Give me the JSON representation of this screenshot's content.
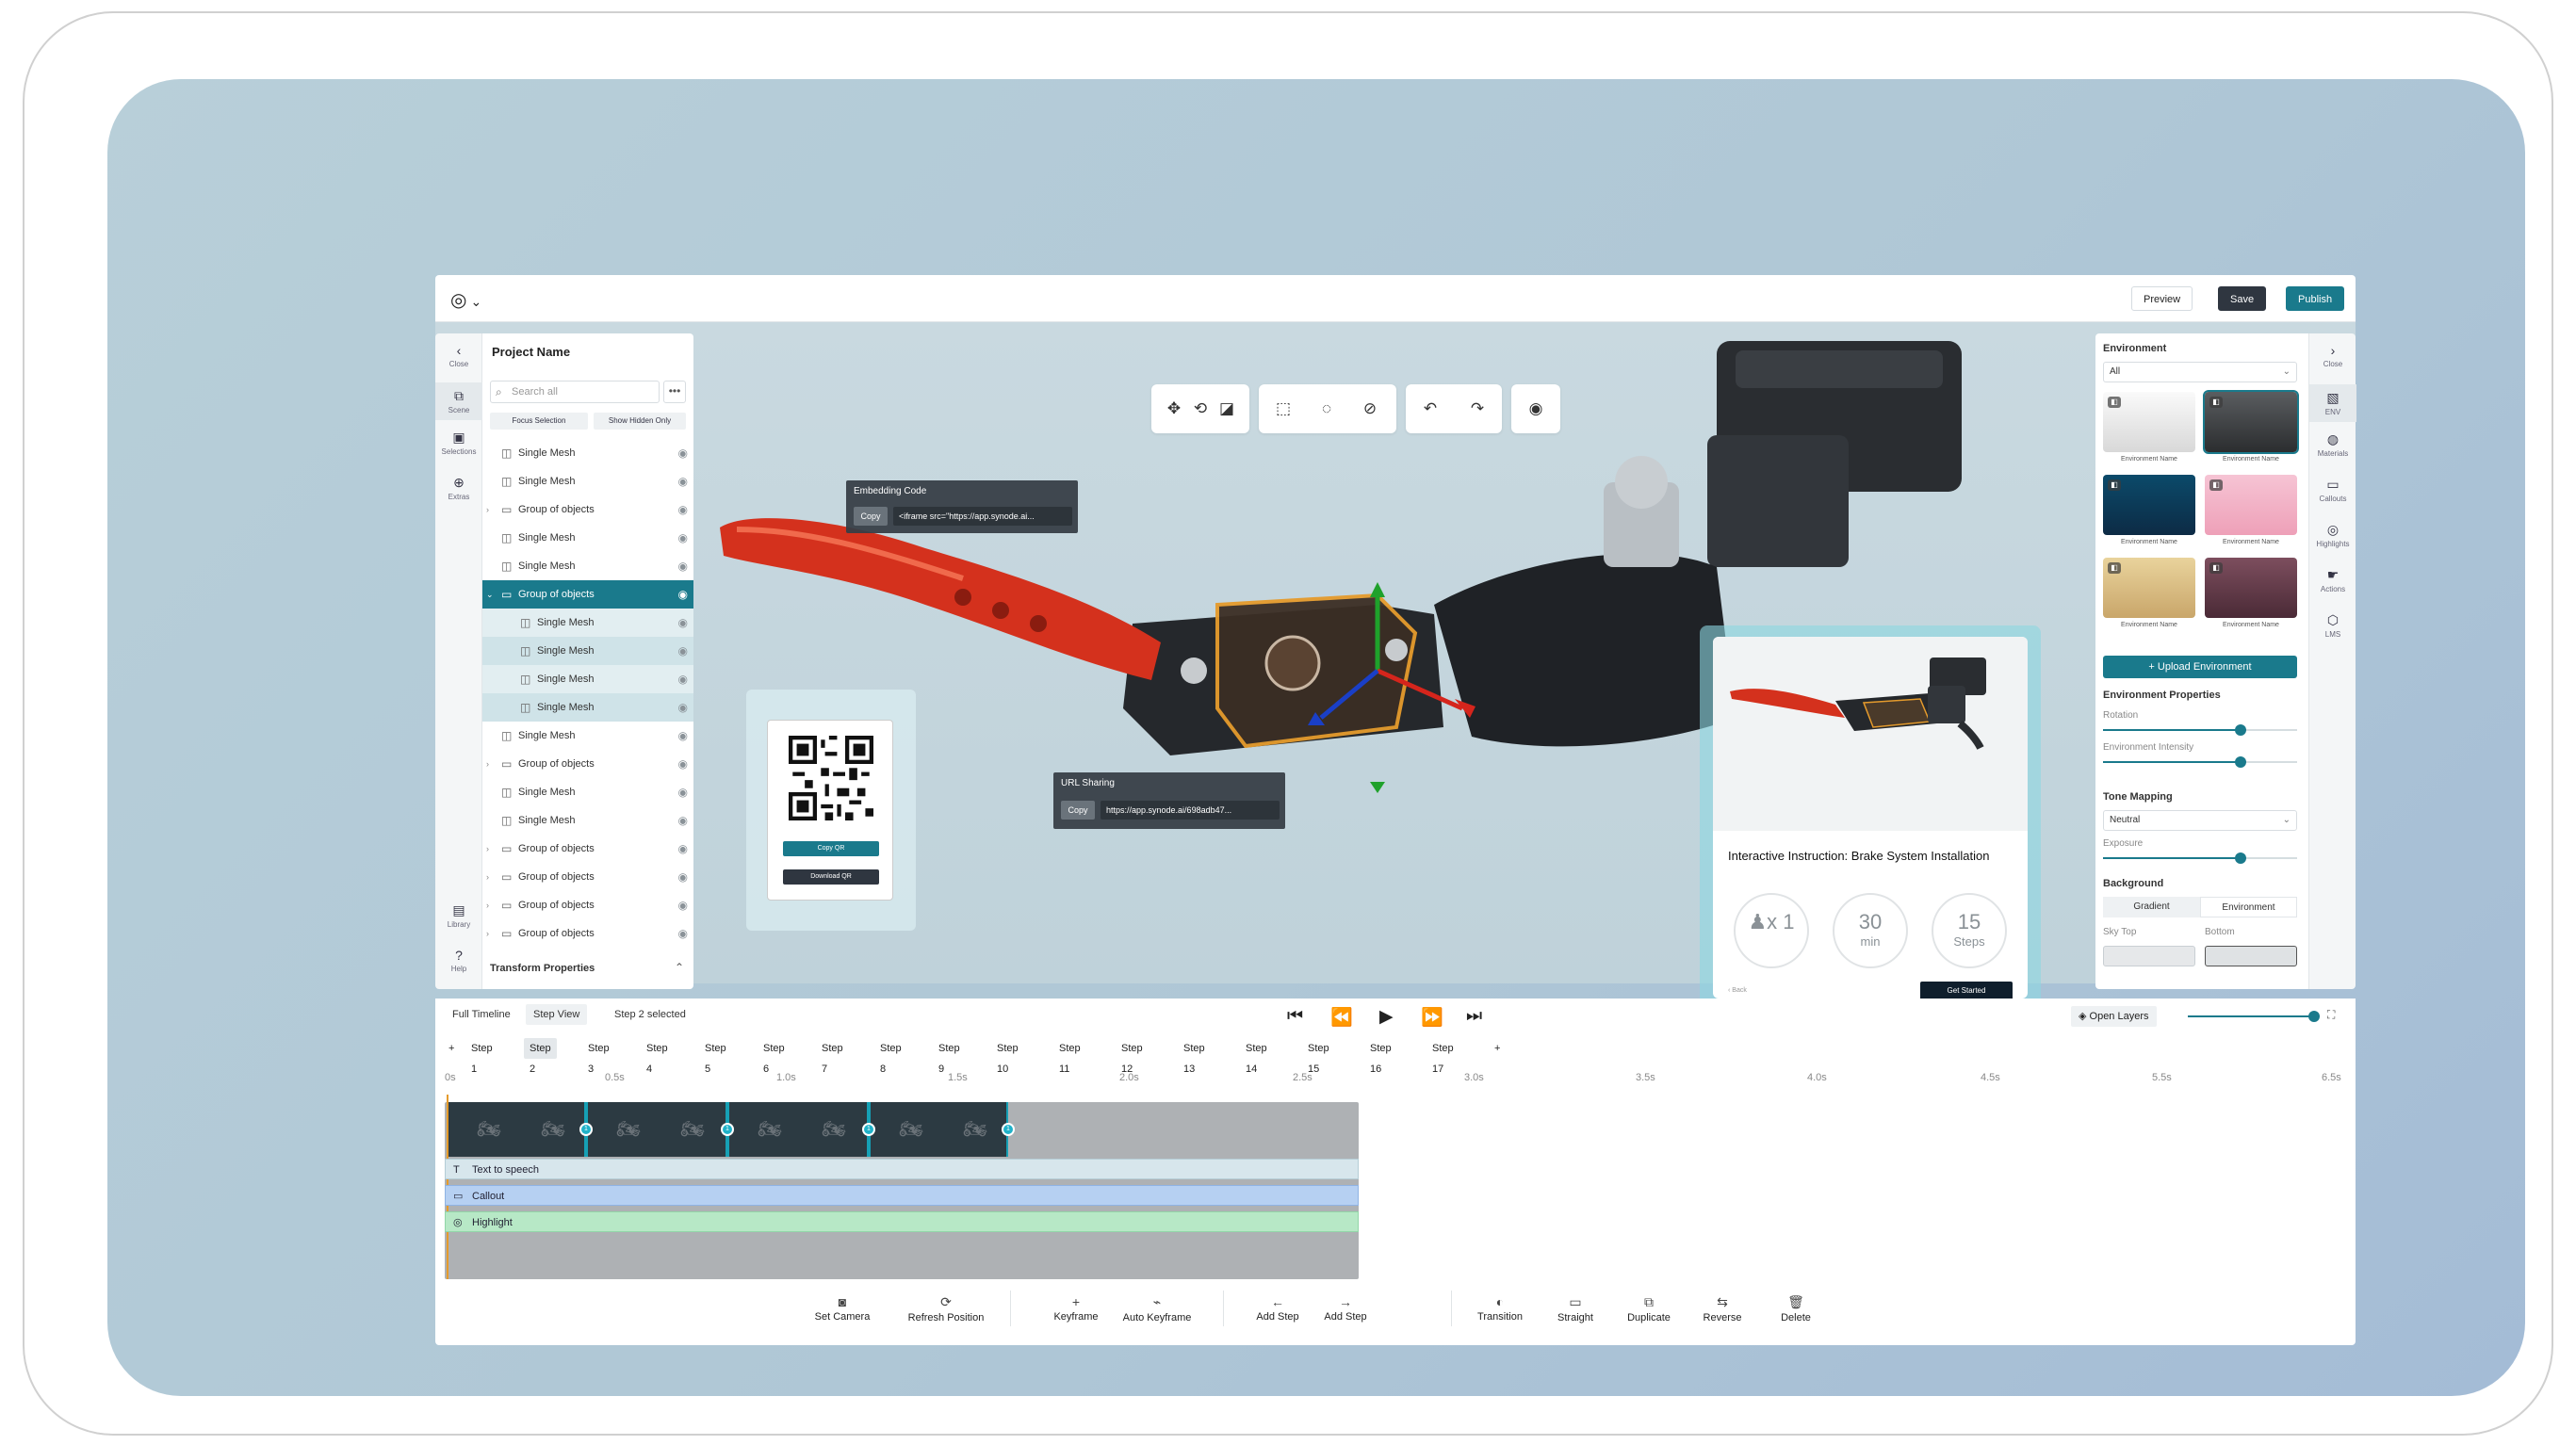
{
  "header": {
    "preview": "Preview",
    "save": "Save",
    "publish": "Publish"
  },
  "left_rail": [
    {
      "label": "Close",
      "icon": "chevron-left-icon"
    },
    {
      "label": "Scene",
      "icon": "scene-icon"
    },
    {
      "label": "Selections",
      "icon": "selection-icon"
    },
    {
      "label": "Extras",
      "icon": "plus-circle-icon"
    },
    {
      "label": "Library",
      "icon": "library-icon"
    },
    {
      "label": "Help",
      "icon": "help-icon"
    }
  ],
  "scene": {
    "project_name": "Project Name",
    "search_placeholder": "Search all",
    "focus_selection": "Focus Selection",
    "show_hidden": "Show Hidden Only",
    "tree": [
      {
        "label": "Single Mesh",
        "type": "mesh"
      },
      {
        "label": "Single Mesh",
        "type": "mesh"
      },
      {
        "label": "Group of objects",
        "type": "group"
      },
      {
        "label": "Single Mesh",
        "type": "mesh"
      },
      {
        "label": "Single Mesh",
        "type": "mesh"
      },
      {
        "label": "Group of objects",
        "type": "group-open"
      },
      {
        "label": "Single Mesh",
        "type": "child"
      },
      {
        "label": "Single Mesh",
        "type": "child"
      },
      {
        "label": "Single Mesh",
        "type": "child"
      },
      {
        "label": "Single Mesh",
        "type": "child"
      },
      {
        "label": "Single Mesh",
        "type": "mesh"
      },
      {
        "label": "Group of objects",
        "type": "group"
      },
      {
        "label": "Single Mesh",
        "type": "mesh"
      },
      {
        "label": "Single Mesh",
        "type": "mesh"
      },
      {
        "label": "Group of objects",
        "type": "group"
      },
      {
        "label": "Group of objects",
        "type": "group"
      },
      {
        "label": "Group of objects",
        "type": "group"
      },
      {
        "label": "Group of objects",
        "type": "group"
      }
    ],
    "transform_properties": "Transform Properties"
  },
  "viewport": {
    "embedding_title": "Embedding Code",
    "copy": "Copy",
    "embedding_value": "<iframe src=\"https://app.synode.ai...",
    "url_title": "URL Sharing",
    "url_value": "https://app.synode.ai/698adb47...",
    "copy_qr": "Copy QR",
    "download_qr": "Download QR",
    "instruction": {
      "title": "Interactive Instruction: Brake System Installation",
      "people": "1",
      "people_prefix": "x",
      "minutes": "30",
      "minutes_unit": "min",
      "steps": "15",
      "steps_unit": "Steps",
      "back": "‹ Back",
      "get_started": "Get Started"
    }
  },
  "right_panel": {
    "environment_title": "Environment",
    "env_filter": "All",
    "env_name": "Environment Name",
    "upload": "Upload Environment",
    "env_props_title": "Environment Properties",
    "rotation_label": "Rotation",
    "rotation": 0.71,
    "intensity_label": "Environment Intensity",
    "intensity": 0.71,
    "tone_title": "Tone Mapping",
    "tone_value": "Neutral",
    "exposure_label": "Exposure",
    "exposure": 0.71,
    "background_title": "Background",
    "bg_gradient": "Gradient",
    "bg_environment": "Environment",
    "sky_top": "Sky Top",
    "bottom": "Bottom"
  },
  "right_rail": [
    {
      "label": "Close",
      "icon": "chevron-right-icon"
    },
    {
      "label": "ENV",
      "icon": "image-icon"
    },
    {
      "label": "Materials",
      "icon": "materials-icon"
    },
    {
      "label": "Callouts",
      "icon": "callout-icon"
    },
    {
      "label": "Highlights",
      "icon": "highlight-icon"
    },
    {
      "label": "Actions",
      "icon": "actions-icon"
    },
    {
      "label": "LMS",
      "icon": "lms-icon"
    }
  ],
  "timeline": {
    "full_timeline": "Full Timeline",
    "step_view": "Step View",
    "selected": "Step 2 selected",
    "open_layers": "Open Layers",
    "steps": [
      "Step 1",
      "Step 2",
      "Step 3",
      "Step 4",
      "Step 5",
      "Step 6",
      "Step 7",
      "Step 8",
      "Step 9",
      "Step 10",
      "Step 11",
      "Step 12",
      "Step 13",
      "Step 14",
      "Step 15",
      "Step 16",
      "Step 17"
    ],
    "ticks": [
      "0s",
      "0.5s",
      "1.0s",
      "1.5s",
      "2.0s",
      "2.5s",
      "3.0s",
      "3.5s",
      "4.0s",
      "4.5s",
      "5.5s",
      "6.5s"
    ],
    "keyframe_marker": "1",
    "tracks": {
      "tts": "Text to speech",
      "callout": "Callout",
      "highlight": "Highlight"
    },
    "actions": [
      "Set Camera",
      "Refresh Position",
      "Keyframe",
      "Auto Keyframe",
      "Add Step",
      "Add Step",
      "Transition",
      "Straight",
      "Duplicate",
      "Reverse",
      "Delete"
    ]
  }
}
